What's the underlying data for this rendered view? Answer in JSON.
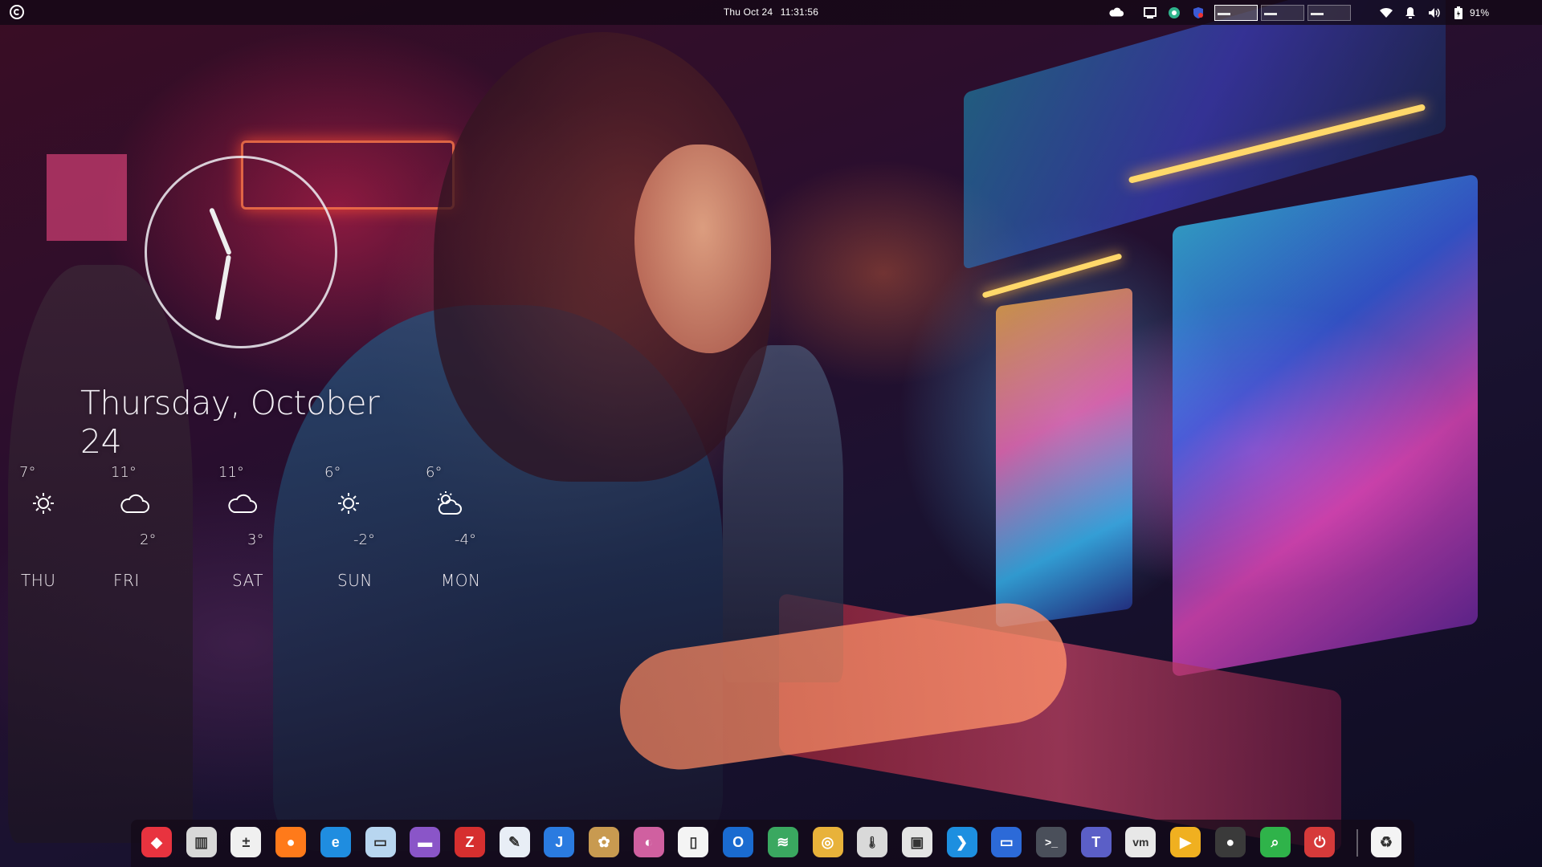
{
  "top_panel": {
    "clock_date": "Thu Oct 24",
    "clock_time": "11:31:56",
    "battery_percent": "91%",
    "tray_icons": [
      "weather-cloud-icon",
      "window-icon",
      "teams-status-icon",
      "shield-tray-icon",
      "cpu-monitor-1",
      "cpu-monitor-2",
      "cpu-monitor-3",
      "wifi-icon",
      "notification-bell-icon",
      "volume-icon",
      "battery-icon"
    ]
  },
  "widget": {
    "date": "Thursday, October 24",
    "forecast": [
      {
        "day": "THU",
        "high": "7°",
        "low": "",
        "icon": "sun-icon"
      },
      {
        "day": "FRI",
        "high": "11°",
        "low": "2°",
        "icon": "cloud-icon"
      },
      {
        "day": "SAT",
        "high": "11°",
        "low": "3°",
        "icon": "cloud-icon"
      },
      {
        "day": "SUN",
        "high": "6°",
        "low": "-2°",
        "icon": "sun-icon"
      },
      {
        "day": "MON",
        "high": "6°",
        "low": "-4°",
        "icon": "partly-cloudy-icon"
      }
    ]
  },
  "dock": {
    "items": [
      {
        "name": "app-launcher-icon",
        "color": "#e8333f",
        "glyph": "◆"
      },
      {
        "name": "archive-manager-icon",
        "color": "#d8d8d8",
        "glyph": "▥"
      },
      {
        "name": "calculator-icon",
        "color": "#f0f0f0",
        "glyph": "±"
      },
      {
        "name": "firefox-icon",
        "color": "#ff7a1a",
        "glyph": "●"
      },
      {
        "name": "edge-browser-icon",
        "color": "#1f8de0",
        "glyph": "e"
      },
      {
        "name": "window-app-icon",
        "color": "#b8d6f0",
        "glyph": "▭"
      },
      {
        "name": "files-folder-icon",
        "color": "#8a55c8",
        "glyph": "▬"
      },
      {
        "name": "filezilla-icon",
        "color": "#d62f2f",
        "glyph": "Z"
      },
      {
        "name": "text-editor-icon",
        "color": "#e8eef6",
        "glyph": "✎"
      },
      {
        "name": "jdownloader-icon",
        "color": "#2a7be0",
        "glyph": "J"
      },
      {
        "name": "paint-palette-icon",
        "color": "#c89a50",
        "glyph": "✿"
      },
      {
        "name": "color-picker-icon",
        "color": "#d060a0",
        "glyph": "◐"
      },
      {
        "name": "document-icon",
        "color": "#f4f4f4",
        "glyph": "▯"
      },
      {
        "name": "outlook-icon",
        "color": "#1a6bd0",
        "glyph": "O"
      },
      {
        "name": "layers-stack-icon",
        "color": "#3aa860",
        "glyph": "≋"
      },
      {
        "name": "audio-player-icon",
        "color": "#e8b23a",
        "glyph": "◎"
      },
      {
        "name": "thermometer-icon",
        "color": "#d9d9d9",
        "glyph": "🌡"
      },
      {
        "name": "remote-desktop-icon",
        "color": "#e4e4e4",
        "glyph": "▣"
      },
      {
        "name": "vscode-icon",
        "color": "#1d8fe0",
        "glyph": "❯"
      },
      {
        "name": "virtual-machine-icon",
        "color": "#2c6ad8",
        "glyph": "▭"
      },
      {
        "name": "terminal-icon",
        "color": "#4a4f5a",
        "glyph": ">_"
      },
      {
        "name": "teams-icon",
        "color": "#5b5fc7",
        "glyph": "T"
      },
      {
        "name": "vmware-icon",
        "color": "#e8e8e8",
        "glyph": "vm"
      },
      {
        "name": "media-player-icon",
        "color": "#f0b020",
        "glyph": "▶"
      },
      {
        "name": "system-settings-icon",
        "color": "#3a3a3a",
        "glyph": "●"
      },
      {
        "name": "search-tool-icon",
        "color": "#2fb34a",
        "glyph": "⌕"
      },
      {
        "name": "power-timer-icon",
        "color": "#d63a3a",
        "glyph": "⏻"
      },
      {
        "name": "trash-icon",
        "color": "#f4f4f4",
        "glyph": "♻"
      }
    ]
  }
}
